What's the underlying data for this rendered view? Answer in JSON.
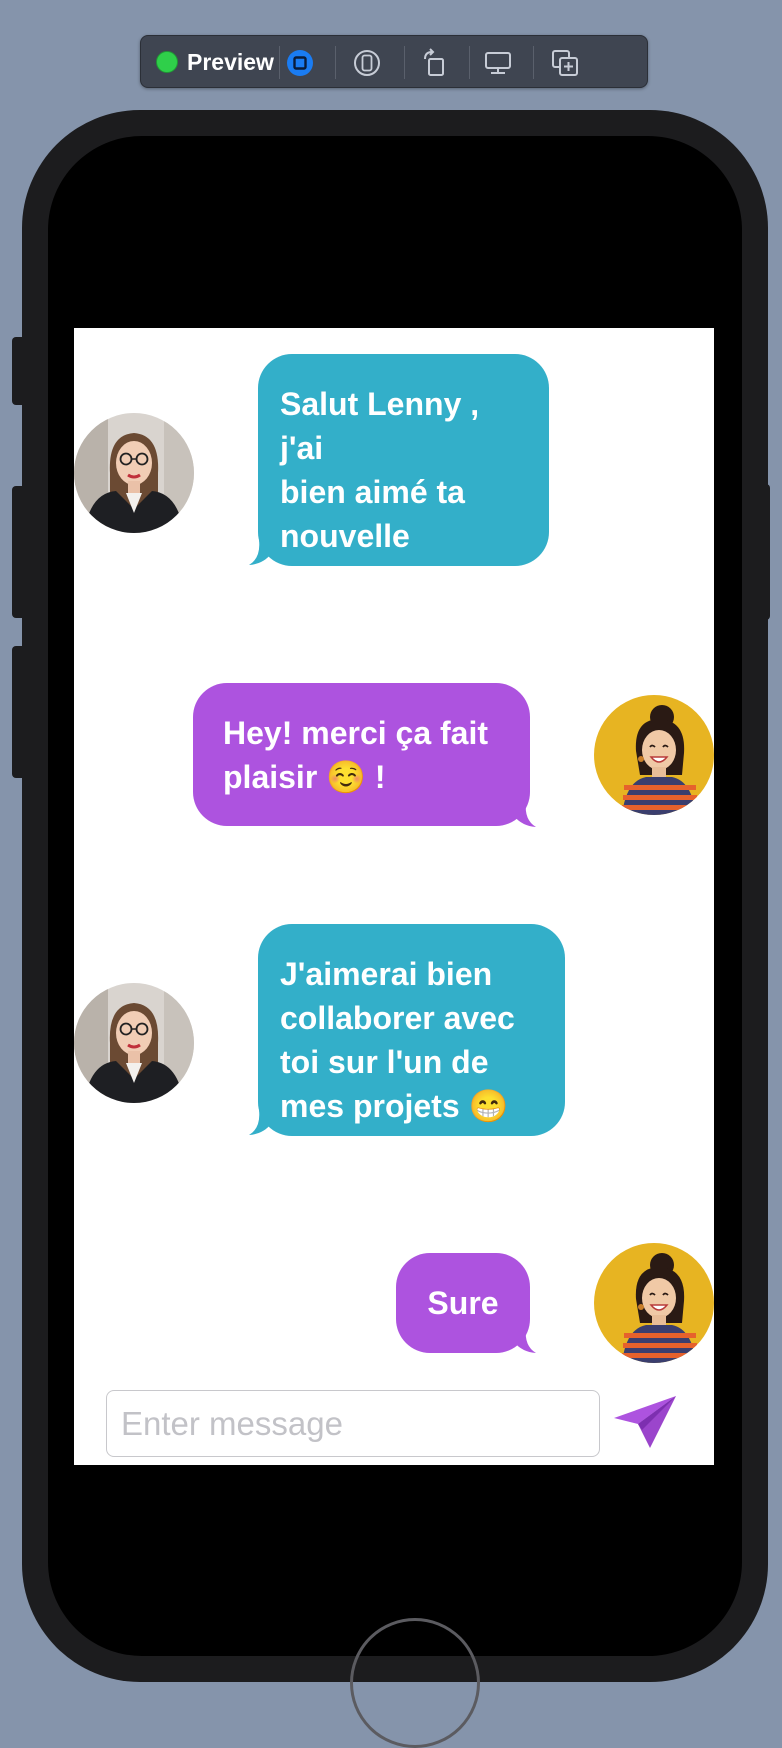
{
  "toolbar": {
    "status_color": "#2fcf4a",
    "label": "Preview",
    "buttons": [
      {
        "icon": "live-preview-icon",
        "active": true
      },
      {
        "icon": "device-inspect-icon",
        "active": false
      },
      {
        "icon": "rotate-icon",
        "active": false
      },
      {
        "icon": "device-settings-icon",
        "active": false
      },
      {
        "icon": "duplicate-preview-icon",
        "active": false
      }
    ]
  },
  "colors": {
    "incoming_bubble": "#33afc9",
    "outgoing_bubble": "#ad53df",
    "send_icon": "#ad53df"
  },
  "messages": [
    {
      "sender": "other",
      "avatar": "woman-glasses-avatar",
      "text": "Salut Lenny , j'ai\nbien aimé ta\nnouvelle\npublication!"
    },
    {
      "sender": "me",
      "avatar": "woman-yellow-avatar",
      "text": "Hey! merci ça fait\nplaisir ☺️ !"
    },
    {
      "sender": "other",
      "avatar": "woman-glasses-avatar",
      "text": "J'aimerai bien\ncollaborer avec\ntoi sur l'un de\nmes projets 😁"
    },
    {
      "sender": "me",
      "avatar": "woman-yellow-avatar",
      "text": "Sure"
    }
  ],
  "composer": {
    "placeholder": "Enter message",
    "value": "",
    "send_icon": "paper-plane-icon"
  }
}
